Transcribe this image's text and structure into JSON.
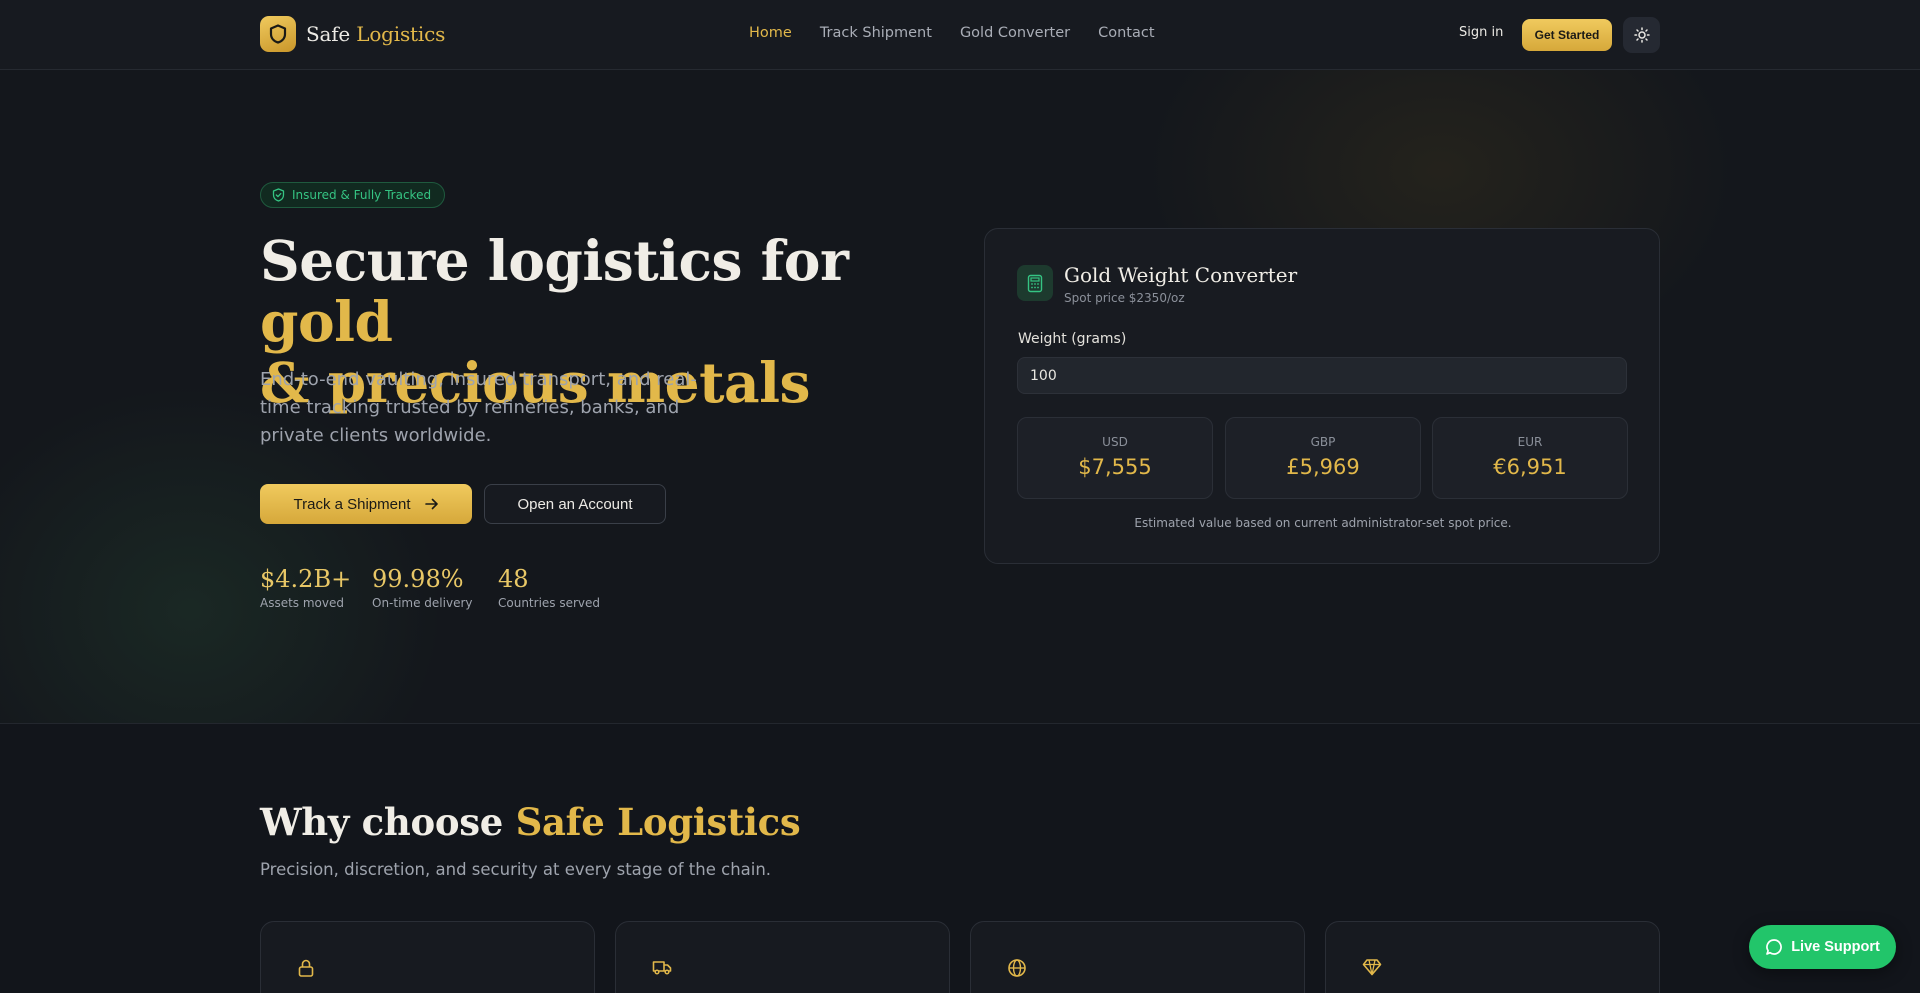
{
  "header": {
    "brand_first": "Safe",
    "brand_second": "Logistics",
    "nav": [
      "Home",
      "Track Shipment",
      "Gold Converter",
      "Contact"
    ],
    "active_nav": "Home",
    "signin": "Sign in",
    "get_started": "Get Started"
  },
  "hero": {
    "badge": "Insured & Fully Tracked",
    "title_white": "Secure logistics for ",
    "title_gold_1": "gold",
    "title_gold_2": "& precious metals",
    "subtitle": "End-to-end vaulting, insured transport, and real-time tracking trusted by refineries, banks, and private clients worldwide.",
    "primary_cta": "Track a Shipment",
    "secondary_cta": "Open an Account",
    "stats": [
      {
        "value": "$4.2B+",
        "label": "Assets moved"
      },
      {
        "value": "99.98%",
        "label": "On-time delivery"
      },
      {
        "value": "48",
        "label": "Countries served"
      }
    ]
  },
  "converter": {
    "title": "Gold Weight Converter",
    "spot": "Spot price $2350/oz",
    "weight_label": "Weight (grams)",
    "weight_value": "100",
    "currencies": [
      {
        "code": "USD",
        "value": "$7,555"
      },
      {
        "code": "GBP",
        "value": "£5,969"
      },
      {
        "code": "EUR",
        "value": "€6,951"
      }
    ],
    "footnote": "Estimated value based on current administrator-set spot price."
  },
  "why": {
    "title_white": "Why choose ",
    "title_gold": "Safe Logistics",
    "subtitle": "Precision, discretion, and security at every stage of the chain.",
    "feature_icons": [
      "lock-icon",
      "truck-icon",
      "globe-icon",
      "gem-icon"
    ]
  },
  "support": {
    "label": "Live Support"
  },
  "colors": {
    "gold": "#e2b84a",
    "green": "#22c56a",
    "background": "#12151b"
  }
}
